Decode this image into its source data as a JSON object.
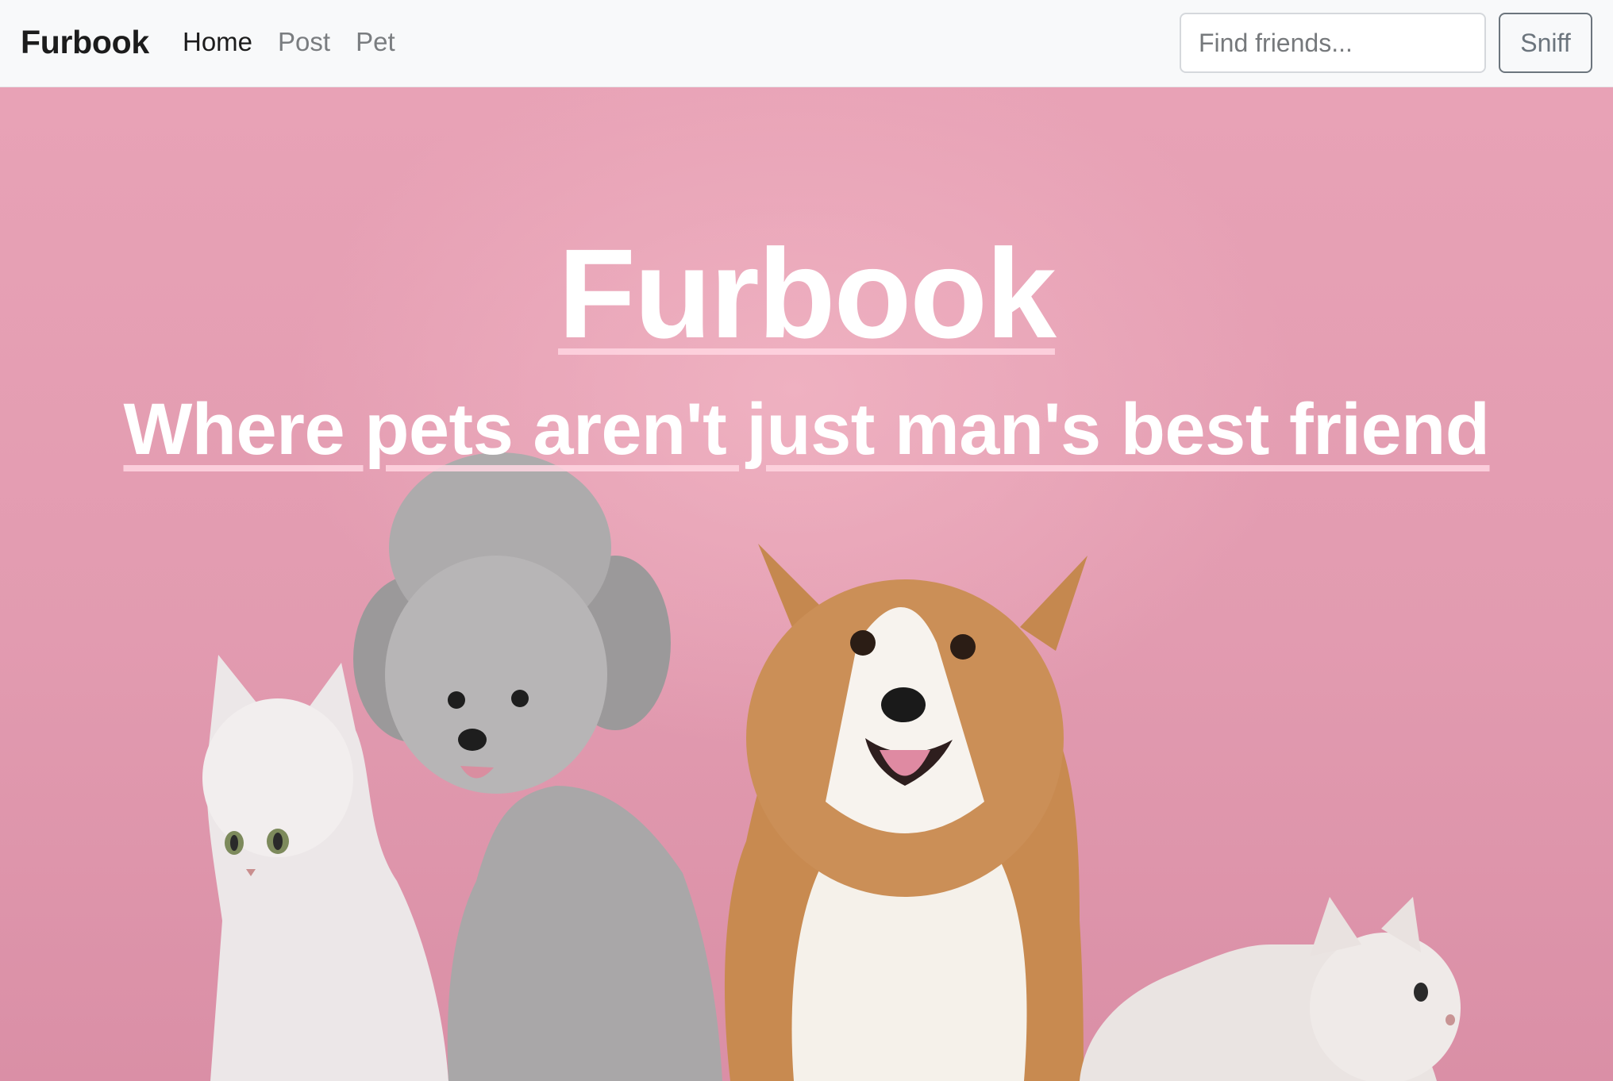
{
  "navbar": {
    "brand": "Furbook",
    "links": [
      {
        "label": "Home",
        "active": true
      },
      {
        "label": "Post",
        "active": false
      },
      {
        "label": "Pet",
        "active": false
      }
    ],
    "search": {
      "placeholder": "Find friends...",
      "value": ""
    },
    "search_button": "Sniff"
  },
  "hero": {
    "title": "Furbook",
    "subtitle": "Where pets aren't just man's best friend",
    "image": "photo of two cats, a grey poodle and a corgi on pink background",
    "background_color": "#e8a2b6"
  }
}
